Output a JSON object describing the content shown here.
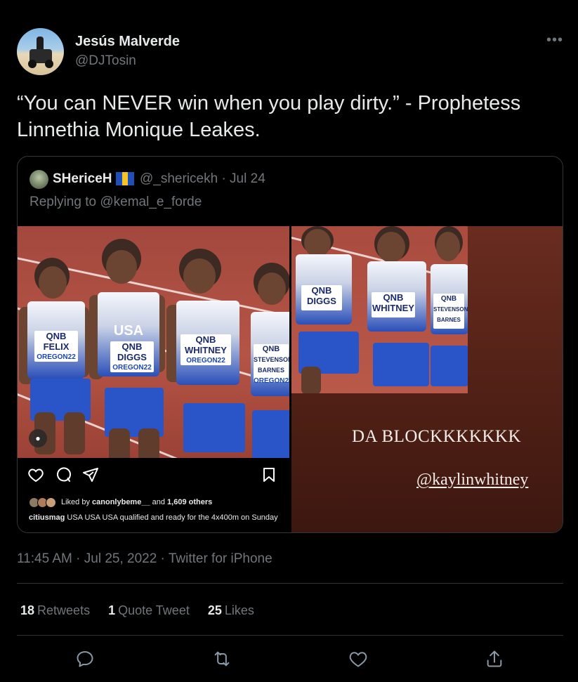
{
  "author": {
    "name": "Jesús Malverde",
    "handle": "@DJTosin"
  },
  "tweet": {
    "text": "“You can NEVER win when you play dirty.” - Prophetess Linnethia Monique Leakes."
  },
  "quoted": {
    "name": "SHericeH",
    "flag": "barbados-flag",
    "meta": "@_shericekh · Jul 24",
    "reply_prefix": "Replying to ",
    "reply_to": "@kemal_e_forde",
    "instagram": {
      "liked_by_prefix": "Liked by ",
      "liked_by_user": "canonlybeme__",
      "liked_by_mid": " and ",
      "liked_by_count": "1,609 others",
      "caption_user": "citiusmag",
      "caption_text": " USA USA USA qualified and ready for the 4x400m on Sunday",
      "runners": [
        {
          "brand": "QNB",
          "name": "FELIX",
          "sub": "OREGON22"
        },
        {
          "brand": "QNB",
          "name": "DIGGS",
          "sub": "OREGON22"
        },
        {
          "brand": "QNB",
          "name": "WHITNEY",
          "sub": "OREGON22"
        },
        {
          "brand": "QNB",
          "name": "STEVENSON BARNES",
          "sub": "OREGON22"
        }
      ],
      "jersey_text": "USA"
    },
    "story": {
      "title": "DA BLOCKKKKKKK",
      "handle": "@kaylinwhitney",
      "runners": [
        {
          "brand": "QNB",
          "name": "DIGGS"
        },
        {
          "brand": "QNB",
          "name": "WHITNEY"
        },
        {
          "brand": "QNB",
          "name": "STEVENSON BARNES"
        }
      ]
    }
  },
  "timestamp": "11:45 AM · Jul 25, 2022 · Twitter for iPhone",
  "stats": {
    "retweets_num": "18",
    "retweets_label": "Retweets",
    "quotes_num": "1",
    "quotes_label": "Quote Tweet",
    "likes_num": "25",
    "likes_label": "Likes"
  },
  "actions": [
    "reply-icon",
    "retweet-icon",
    "like-icon",
    "share-icon"
  ],
  "colors": {
    "background": "#000000",
    "text": "#e7e9ea",
    "muted": "#71767b",
    "border": "#2f3336"
  }
}
